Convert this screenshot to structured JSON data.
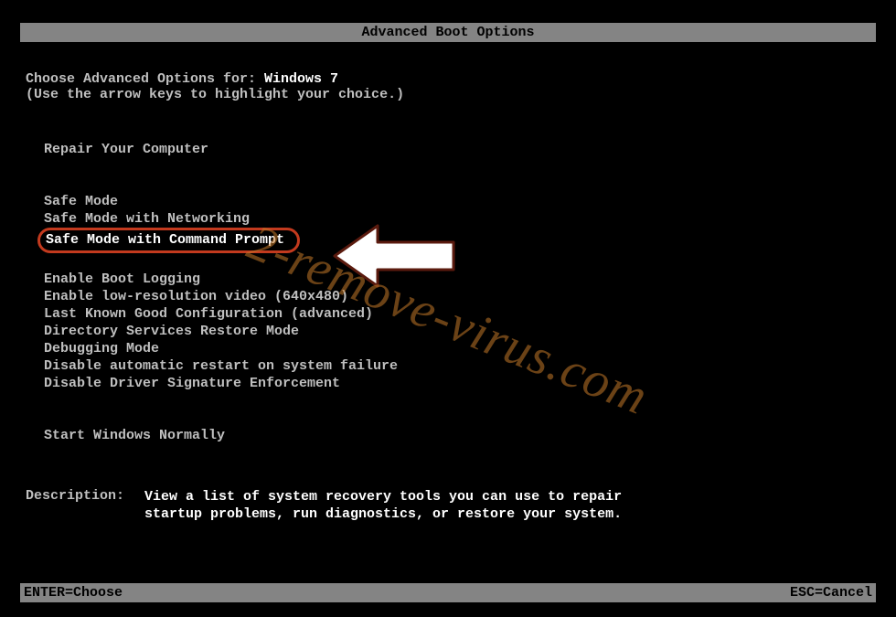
{
  "title": "Advanced Boot Options",
  "header": {
    "choose_prefix": "Choose Advanced Options for: ",
    "os_name": "Windows 7",
    "hint": "(Use the arrow keys to highlight your choice.)"
  },
  "menu": {
    "group1": [
      "Repair Your Computer"
    ],
    "group2": [
      "Safe Mode",
      "Safe Mode with Networking",
      "Safe Mode with Command Prompt"
    ],
    "group3": [
      "Enable Boot Logging",
      "Enable low-resolution video (640x480)",
      "Last Known Good Configuration (advanced)",
      "Directory Services Restore Mode",
      "Debugging Mode",
      "Disable automatic restart on system failure",
      "Disable Driver Signature Enforcement"
    ],
    "group4": [
      "Start Windows Normally"
    ],
    "highlighted_index": 2
  },
  "description": {
    "label": "Description:",
    "text_line1": "View a list of system recovery tools you can use to repair",
    "text_line2": "startup problems, run diagnostics, or restore your system."
  },
  "footer": {
    "left": "ENTER=Choose",
    "right": "ESC=Cancel"
  },
  "watermark": "2-remove-virus.com"
}
